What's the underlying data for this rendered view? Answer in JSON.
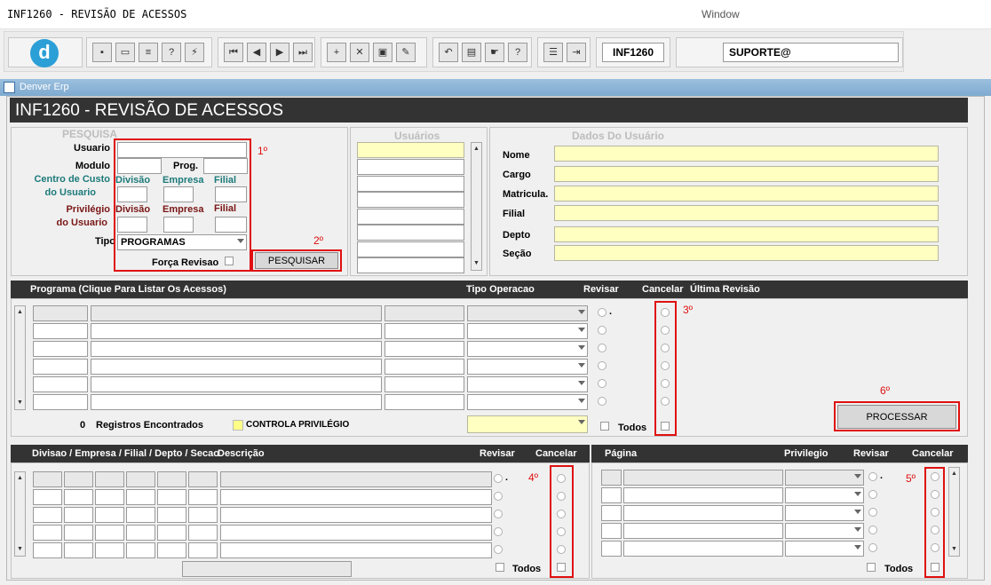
{
  "window": {
    "title": "INF1260 - REVISÃO DE ACESSOS",
    "menu": "Window"
  },
  "toolbar": {
    "form_code": "INF1260",
    "user": "SUPORTE@"
  },
  "app": {
    "title": "Denver Erp"
  },
  "form": {
    "title": "INF1260 - REVISÃO DE ACESSOS"
  },
  "search": {
    "section": "PESQUISA",
    "usuario": "Usuario",
    "modulo": "Modulo",
    "prog": "Prog.",
    "centro1": "Centro de Custo",
    "centro2": "do Usuario",
    "priv1": "Privilégio",
    "priv2": "do Usuario",
    "divisao": "Divisão",
    "empresa": "Empresa",
    "filial": "Filial",
    "tipo": "Tipo",
    "tipo_value": "PROGRAMAS",
    "forca": "Força Revisao",
    "button": "PESQUISAR"
  },
  "users": {
    "header": "Usuários"
  },
  "details": {
    "header": "Dados Do Usuário",
    "nome": "Nome",
    "cargo": "Cargo",
    "matricula": "Matricula.",
    "filial": "Filial",
    "depto": "Depto",
    "secao": "Seção"
  },
  "programs": {
    "h_programa": "Programa (Clique Para Listar Os Acessos)",
    "h_tipo": "Tipo Operacao",
    "h_revisar": "Revisar",
    "h_cancelar": "Cancelar",
    "h_ultima": "Última Revisão",
    "count": "0",
    "found": "Registros Encontrados",
    "controla": "CONTROLA PRIVILÉGIO",
    "todos": "Todos",
    "process": "PROCESSAR",
    "dot": "."
  },
  "divisions": {
    "h_div": "Divisao / Empresa / Filial / Depto / Secao",
    "h_desc": "Descrição",
    "h_revisar": "Revisar",
    "h_cancelar": "Cancelar",
    "todos": "Todos",
    "dot": "."
  },
  "pages": {
    "h_pagina": "Página",
    "h_priv": "Privilegio",
    "h_revisar": "Revisar",
    "h_cancelar": "Cancelar",
    "todos": "Todos",
    "dot": "."
  },
  "annotations": {
    "a1": "1º",
    "a2": "2º",
    "a3": "3º",
    "a4": "4º",
    "a5": "5º",
    "a6": "6º"
  },
  "colors": {
    "highlight": "#e01010",
    "field_yellow": "#ffffc2",
    "header_dark": "#333333"
  }
}
